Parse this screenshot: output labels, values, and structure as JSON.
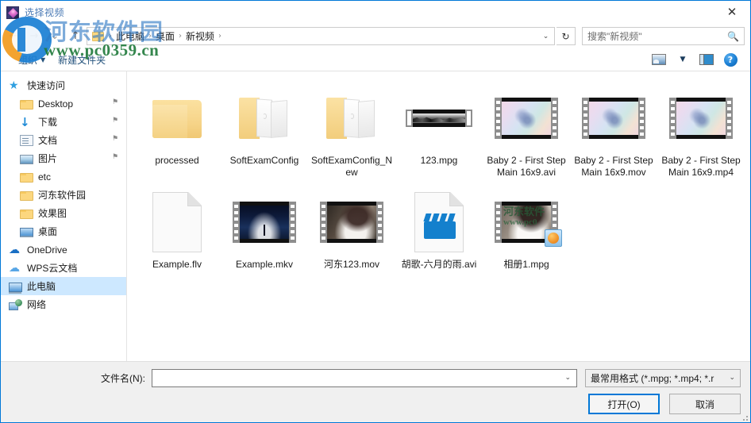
{
  "window": {
    "title": "选择视频",
    "app_icon": "gem-app-icon",
    "close_label": "✕"
  },
  "nav": {
    "back_label": "←",
    "forward_label": "→",
    "recent_label": "⌄",
    "up_label": "↑",
    "refresh_label": "↻",
    "address_dropdown": "⌄",
    "breadcrumbs": [
      {
        "label": "此电脑"
      },
      {
        "label": "桌面"
      },
      {
        "label": "新视频"
      }
    ],
    "separator": "›"
  },
  "search": {
    "placeholder": "搜索\"新视频\"",
    "icon": "search-icon"
  },
  "toolbar": {
    "organize_label": "组织",
    "organize_caret": "▼",
    "new_folder_label": "新建文件夹",
    "view_caret": "▼",
    "icons": {
      "view": "view-options-icon",
      "preview_pane": "preview-pane-icon",
      "help": "?"
    }
  },
  "sidebar": {
    "items": [
      {
        "label": "快速访问",
        "icon": "star-icon",
        "type": "group",
        "pinned": false,
        "selected": false
      },
      {
        "label": "Desktop",
        "icon": "folder-icon",
        "type": "child",
        "pinned": true,
        "selected": false
      },
      {
        "label": "下载",
        "icon": "download-icon",
        "type": "child",
        "pinned": true,
        "selected": false
      },
      {
        "label": "文档",
        "icon": "document-icon",
        "type": "child",
        "pinned": true,
        "selected": false
      },
      {
        "label": "图片",
        "icon": "pictures-icon",
        "type": "child",
        "pinned": true,
        "selected": false
      },
      {
        "label": "etc",
        "icon": "folder-icon",
        "type": "child",
        "pinned": false,
        "selected": false
      },
      {
        "label": "河东软件园",
        "icon": "folder-icon",
        "type": "child",
        "pinned": false,
        "selected": false
      },
      {
        "label": "效果图",
        "icon": "folder-icon",
        "type": "child",
        "pinned": false,
        "selected": false
      },
      {
        "label": "桌面",
        "icon": "desktop-icon",
        "type": "child",
        "pinned": false,
        "selected": false
      },
      {
        "label": "OneDrive",
        "icon": "onedrive-icon",
        "type": "group",
        "pinned": false,
        "selected": false
      },
      {
        "label": "WPS云文档",
        "icon": "wps-cloud-icon",
        "type": "group",
        "pinned": false,
        "selected": false
      },
      {
        "label": "此电脑",
        "icon": "this-pc-icon",
        "type": "group",
        "pinned": false,
        "selected": true
      },
      {
        "label": "网络",
        "icon": "network-icon",
        "type": "group",
        "pinned": false,
        "selected": false
      }
    ],
    "pin_glyph": "📌"
  },
  "files": [
    {
      "name": "processed",
      "kind": "folder-closed"
    },
    {
      "name": "SoftExamConfig",
      "kind": "folder-open"
    },
    {
      "name": "SoftExamConfig_New",
      "kind": "folder-open"
    },
    {
      "name": "123.mpg",
      "kind": "film-wide-gray"
    },
    {
      "name": "Baby 2 - First Step Main 16x9.avi",
      "kind": "film-baby"
    },
    {
      "name": "Baby 2 - First Step Main 16x9.mov",
      "kind": "film-baby"
    },
    {
      "name": "Baby 2 - First Step Main 16x9.mp4",
      "kind": "film-baby"
    },
    {
      "name": "Example.flv",
      "kind": "blank-doc"
    },
    {
      "name": "Example.mkv",
      "kind": "film-mkv"
    },
    {
      "name": "河东123.mov",
      "kind": "film-lady"
    },
    {
      "name": "胡歌-六月的雨.avi",
      "kind": "clapper-doc"
    },
    {
      "name": "相册1.mpg",
      "kind": "film-lady-watermark"
    }
  ],
  "bottom": {
    "filename_label": "文件名(N):",
    "filename_value": "",
    "filter_value": "最常用格式 (*.mpg; *.mp4; *.r",
    "open_label": "打开(O)",
    "cancel_label": "取消",
    "caret": "⌄"
  },
  "watermark": {
    "line1": "河东软件园",
    "line2": "www.pc0359.cn",
    "thumb_text1": "河东软件",
    "thumb_text2": "www.pc0"
  }
}
